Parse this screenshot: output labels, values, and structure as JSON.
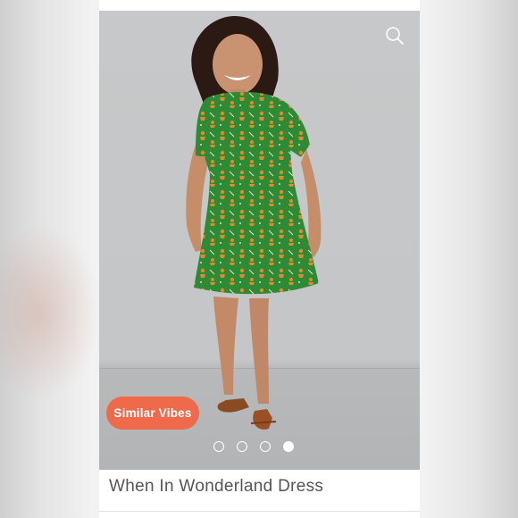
{
  "listing": {
    "title": "When In Wonderland Dress",
    "similar_button_label": "Similar Vibes"
  },
  "photo": {
    "description_icon": "zoom-icon",
    "carousel": {
      "total": 4,
      "active_index": 3
    }
  },
  "colors": {
    "accent": "#ef6a4a",
    "dress_green": "#2e8a34",
    "print_orange": "#e08a2e"
  }
}
